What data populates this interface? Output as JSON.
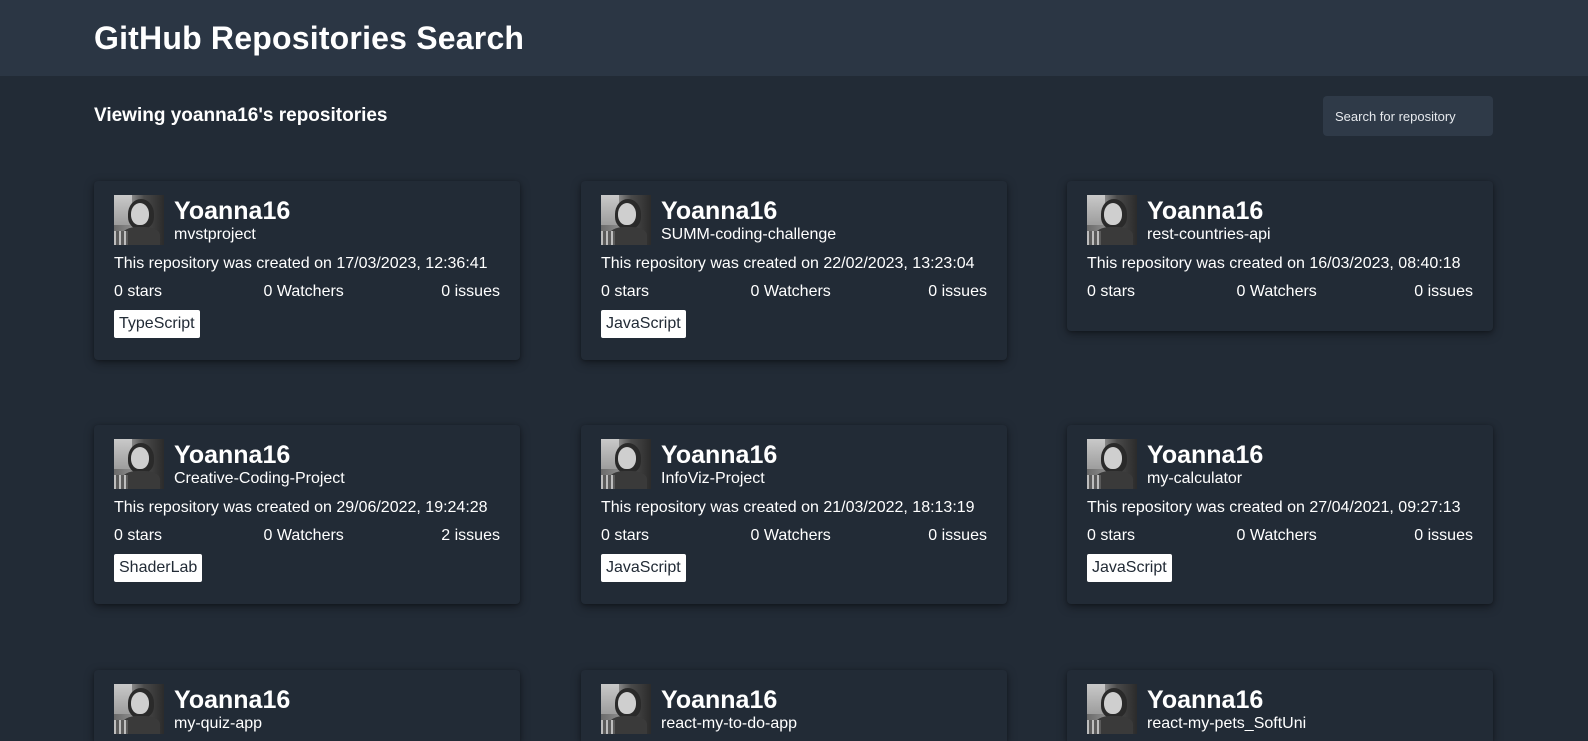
{
  "header": {
    "title": "GitHub Repositories Search"
  },
  "subheader": {
    "text": "Viewing yoanna16's repositories"
  },
  "search": {
    "placeholder": "Search for repository",
    "value": ""
  },
  "colors": {
    "page_background": "#222b36",
    "header_background": "#2b3644",
    "search_background": "#2f3a48",
    "language_badge_background": "#ffffff",
    "text": "#ffffff"
  },
  "cards": [
    {
      "owner": "Yoanna16",
      "repo": "mvstproject",
      "created": "This repository was created on 17/03/2023, 12:36:41",
      "stars": "0 stars",
      "watchers": "0 Watchers",
      "issues": "0 issues",
      "language": "TypeScript"
    },
    {
      "owner": "Yoanna16",
      "repo": "SUMM-coding-challenge",
      "created": "This repository was created on 22/02/2023, 13:23:04",
      "stars": "0 stars",
      "watchers": "0 Watchers",
      "issues": "0 issues",
      "language": "JavaScript"
    },
    {
      "owner": "Yoanna16",
      "repo": "rest-countries-api",
      "created": "This repository was created on 16/03/2023, 08:40:18",
      "stars": "0 stars",
      "watchers": "0 Watchers",
      "issues": "0 issues",
      "language": ""
    },
    {
      "owner": "Yoanna16",
      "repo": "Creative-Coding-Project",
      "created": "This repository was created on 29/06/2022, 19:24:28",
      "stars": "0 stars",
      "watchers": "0 Watchers",
      "issues": "2 issues",
      "language": "ShaderLab"
    },
    {
      "owner": "Yoanna16",
      "repo": "InfoViz-Project",
      "created": "This repository was created on 21/03/2022, 18:13:19",
      "stars": "0 stars",
      "watchers": "0 Watchers",
      "issues": "0 issues",
      "language": "JavaScript"
    },
    {
      "owner": "Yoanna16",
      "repo": "my-calculator",
      "created": "This repository was created on 27/04/2021, 09:27:13",
      "stars": "0 stars",
      "watchers": "0 Watchers",
      "issues": "0 issues",
      "language": "JavaScript"
    },
    {
      "owner": "Yoanna16",
      "repo": "my-quiz-app"
    },
    {
      "owner": "Yoanna16",
      "repo": "react-my-to-do-app"
    },
    {
      "owner": "Yoanna16",
      "repo": "react-my-pets_SoftUni"
    }
  ]
}
